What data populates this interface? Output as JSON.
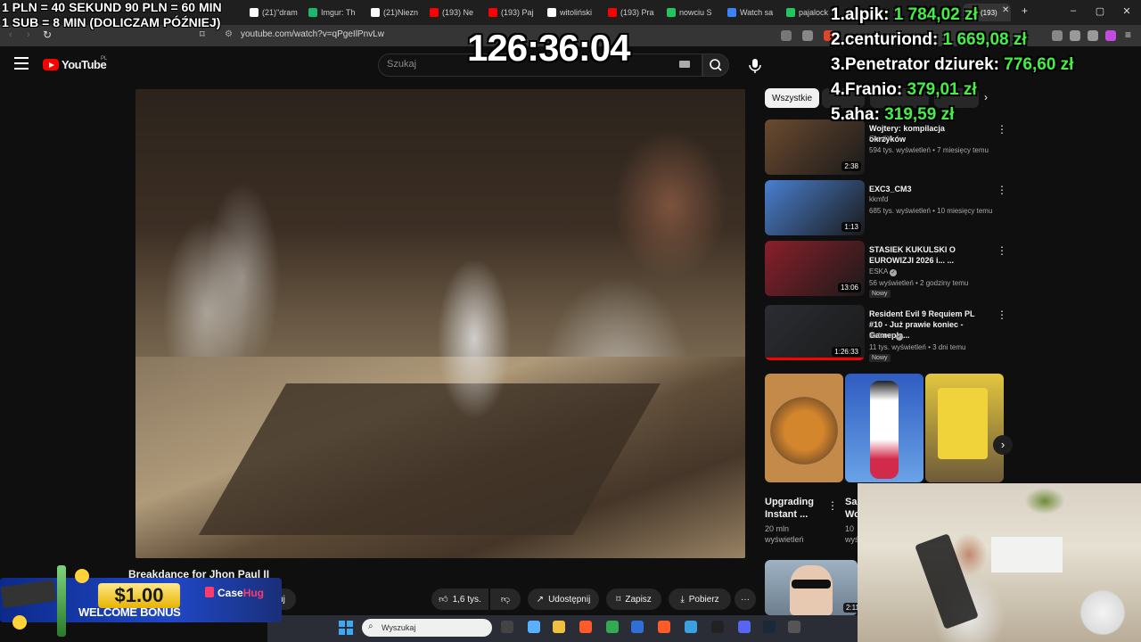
{
  "browser": {
    "tabs": [
      {
        "label": "(21)\"dram",
        "color": "#ffffff"
      },
      {
        "label": "Imgur: Th",
        "color": "#1bb76e"
      },
      {
        "label": "(21)Niezn",
        "color": "#ffffff"
      },
      {
        "label": "(193) Ne",
        "color": "#ff0000"
      },
      {
        "label": "(193) Paj",
        "color": "#ff0000"
      },
      {
        "label": "witoliński",
        "color": "#ffffff"
      },
      {
        "label": "(193) Pra",
        "color": "#ff0000"
      },
      {
        "label": "nowciu S",
        "color": "#22c55e"
      },
      {
        "label": "Watch sa",
        "color": "#3b82f6"
      },
      {
        "label": "pajalock",
        "color": "#22c55e"
      }
    ],
    "url": "youtube.com/watch?v=qPgeIlPnvLw"
  },
  "youtube": {
    "logo_text": "YouTube",
    "logo_region": "PL",
    "search_placeholder": "Szukaj",
    "video_title": "Breakdance for Jhon Paul II",
    "actions": {
      "likes": "1,6 tys.",
      "share": "Udostępnij",
      "save": "Zapisz",
      "download": "Pobierz",
      "subscribe_fragment": "uj"
    },
    "chips": {
      "all": "Wszystkie"
    },
    "recommendations": [
      {
        "title": "Wojtery: kompilacja okrzyków",
        "channel": "GrediX",
        "meta": "594 tys. wyświetleń • 7 miesięcy temu",
        "duration": "2:38",
        "thumb_color": "#6b4a2f",
        "verified": false,
        "new": false
      },
      {
        "title": "EXC3_CM3",
        "channel": "kkmfd",
        "meta": "685 tys. wyświetleń • 10 miesięcy temu",
        "duration": "1:13",
        "thumb_color": "#4a7fd0",
        "verified": false,
        "new": false
      },
      {
        "title": "STASIEK KUKULSKI O EUROWIZJI 2026 i... ...",
        "channel": "ESKA",
        "meta": "56 wyświetleń • 2 godziny temu",
        "duration": "13:06",
        "thumb_color": "#8a1f2a",
        "verified": true,
        "new": true,
        "new_label": "Nowy"
      },
      {
        "title": "Resident Evil 9 Requiem PL #10 - Już prawie koniec - Gamepla...",
        "channel": "Kaftann",
        "meta": "11 tys. wyświetleń • 3 dni temu",
        "duration": "1:26:33",
        "thumb_color": "#2b2d33",
        "verified": true,
        "new": true,
        "new_label": "Nowy"
      }
    ],
    "shorts": [
      {
        "title": "Upgrading Instant ...",
        "views_line1": "20 mln",
        "views_line2": "wyświetleń",
        "color": "#b77a3a"
      },
      {
        "title": "Sai Wo",
        "views_line1": "10",
        "views_line2": "wyś",
        "color": "#3a6fd6"
      },
      {
        "title": "",
        "views_line1": "",
        "views_line2": "",
        "color": "#c7b53a"
      }
    ],
    "bottom_thumb_duration": "2:11"
  },
  "taskbar": {
    "search": "Wyszukaj"
  },
  "overlay": {
    "info_line1": "1 PLN = 40 SEKUND 90 PLN = 60 MIN",
    "info_line2": "1 SUB = 8 MIN (DOLICZAM PÓŹNIEJ)",
    "timer": "126:36:04",
    "leaderboard": [
      {
        "name": "1.alpik:",
        "amount": "1 784,02 zł"
      },
      {
        "name": "2.centuriond:",
        "amount": "1 669,08 zł"
      },
      {
        "name": "3.Penetrator dziurek:",
        "amount": "776,60 zł"
      },
      {
        "name": "4.Franio:",
        "amount": "379,01 zł"
      },
      {
        "name": "5.aha:",
        "amount": "319,59 zł"
      }
    ],
    "bonus": {
      "amount": "$1.00",
      "text": "WELCOME BONUS",
      "brand_a": "Case",
      "brand_b": "Hug"
    }
  }
}
